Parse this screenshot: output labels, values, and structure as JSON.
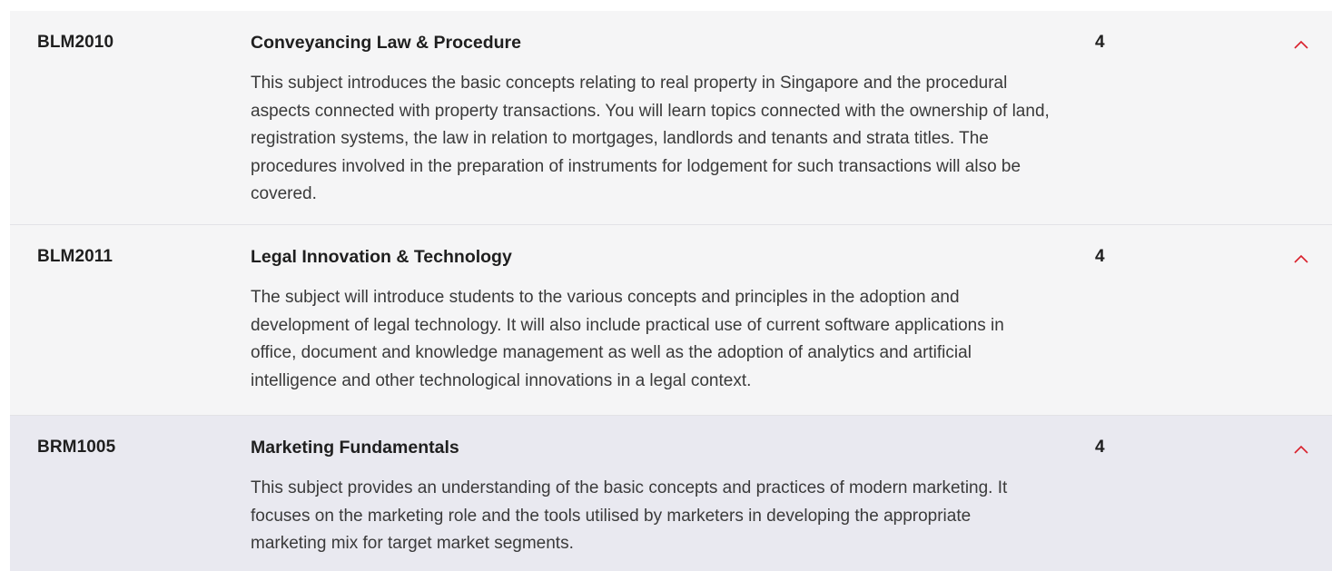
{
  "subjects": [
    {
      "code": "BLM2010",
      "title": "Conveyancing Law & Procedure",
      "credits": "4",
      "description": "This subject introduces the basic concepts relating to real property in Singapore and the procedural aspects connected with property transactions. You will learn topics connected with the ownership of land, registration systems, the law in relation to mortgages, landlords and tenants and strata titles. The procedures involved in the preparation of instruments for lodgement for such transactions will also be covered.",
      "toggle_icon": "chevron-up-icon"
    },
    {
      "code": "BLM2011",
      "title": "Legal Innovation & Technology",
      "credits": "4",
      "description": "The subject will introduce students to the various concepts and principles in the adoption and development of legal technology.  It will also include practical use of current software applications in office, document and knowledge management as well as the adoption of analytics and artificial intelligence and other technological innovations in a legal context.",
      "toggle_icon": "chevron-up-icon"
    },
    {
      "code": "BRM1005",
      "title": "Marketing Fundamentals",
      "credits": "4",
      "description": "This subject provides an understanding of the basic concepts and practices of modern marketing. It focuses on the marketing role and the tools utilised by marketers in developing the appropriate marketing mix for target market segments.",
      "toggle_icon": "chevron-up-icon"
    }
  ],
  "colors": {
    "row_background": "#f5f5f6",
    "row_highlight": "#e9e9f0",
    "divider": "#e2e2e6",
    "accent": "#d9202c",
    "text": "#1f1f1f"
  }
}
